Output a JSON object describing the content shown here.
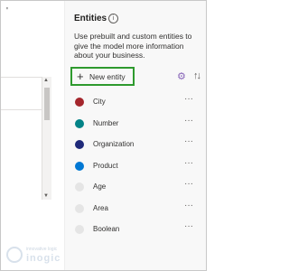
{
  "left_page": {
    "corner_mark": "'"
  },
  "panel": {
    "title": "Entities",
    "info_icon": "i",
    "description": "Use prebuilt and custom entities to give the model more information about your business.",
    "new_entity_label": "New entity",
    "accent_color": "#8764b8",
    "highlight_color": "#2e9a2e"
  },
  "entities": [
    {
      "name": "City",
      "color": "#a4262c",
      "more": "···"
    },
    {
      "name": "Number",
      "color": "#038387",
      "more": "···"
    },
    {
      "name": "Organization",
      "color": "#1f2a7a",
      "more": "···"
    },
    {
      "name": "Product",
      "color": "#0078d4",
      "more": "···"
    },
    {
      "name": "Age",
      "color": "#e5e5e5",
      "more": "···"
    },
    {
      "name": "Area",
      "color": "#e5e5e5",
      "more": "···"
    },
    {
      "name": "Boolean",
      "color": "#e5e5e5",
      "more": "···"
    }
  ],
  "watermark": {
    "tagline": "innovative logic",
    "name": "inogic"
  }
}
